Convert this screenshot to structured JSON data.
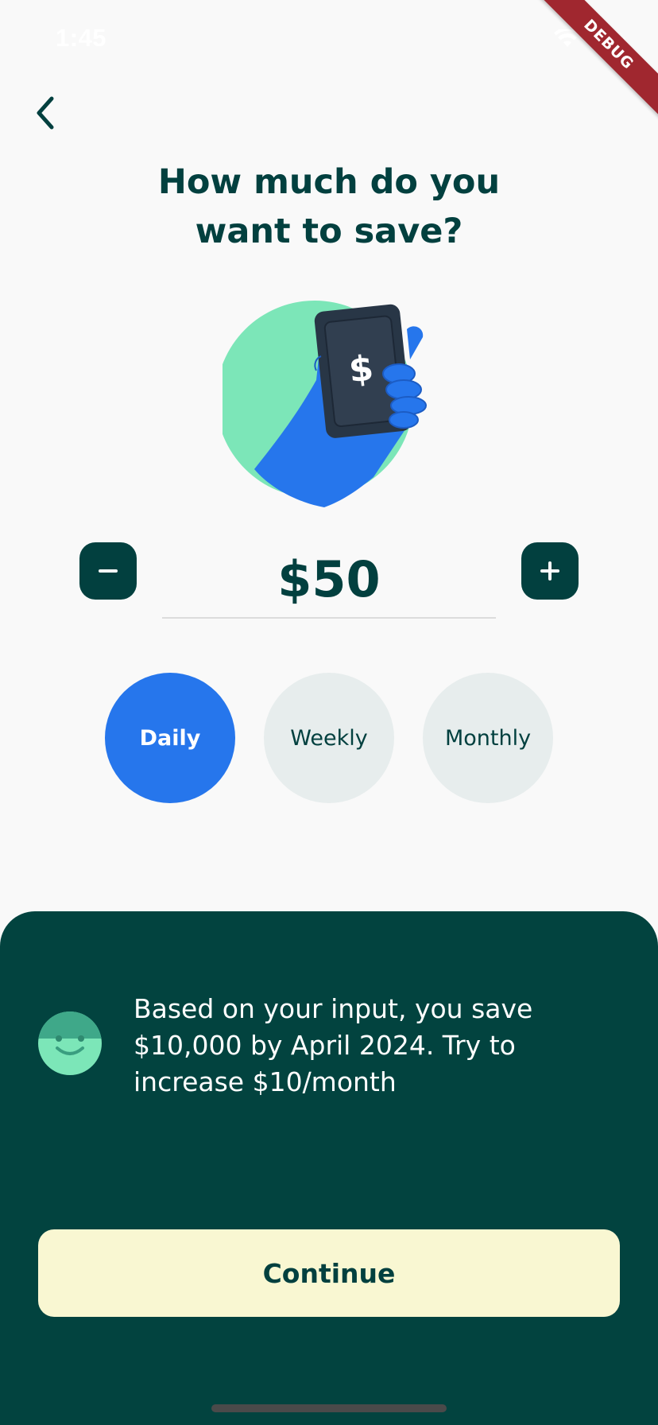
{
  "status_bar": {
    "time": "1:45",
    "debug_label": "DEBUG"
  },
  "header": {
    "title_line1": "How much do you",
    "title_line2": "want to save?"
  },
  "amount": {
    "value": "$50"
  },
  "frequency": {
    "options": [
      "Daily",
      "Weekly",
      "Monthly"
    ],
    "selected": "Daily"
  },
  "info": {
    "message": "Based on your input, you save $10,000 by April 2024. Try to increase $10/month"
  },
  "actions": {
    "continue_label": "Continue"
  },
  "icons": {
    "back": "chevron-left-icon",
    "minus": "minus-icon",
    "plus": "plus-icon",
    "smiley": "smiley-icon",
    "illustration": "hand-holding-phone-dollar"
  },
  "colors": {
    "primary_dark": "#02403f",
    "accent_blue": "#2676ec",
    "mint": "#7ce6b8",
    "unselected_bg": "#e7eded",
    "continue_bg": "#f9f7d2",
    "background": "#f9f9f9"
  }
}
